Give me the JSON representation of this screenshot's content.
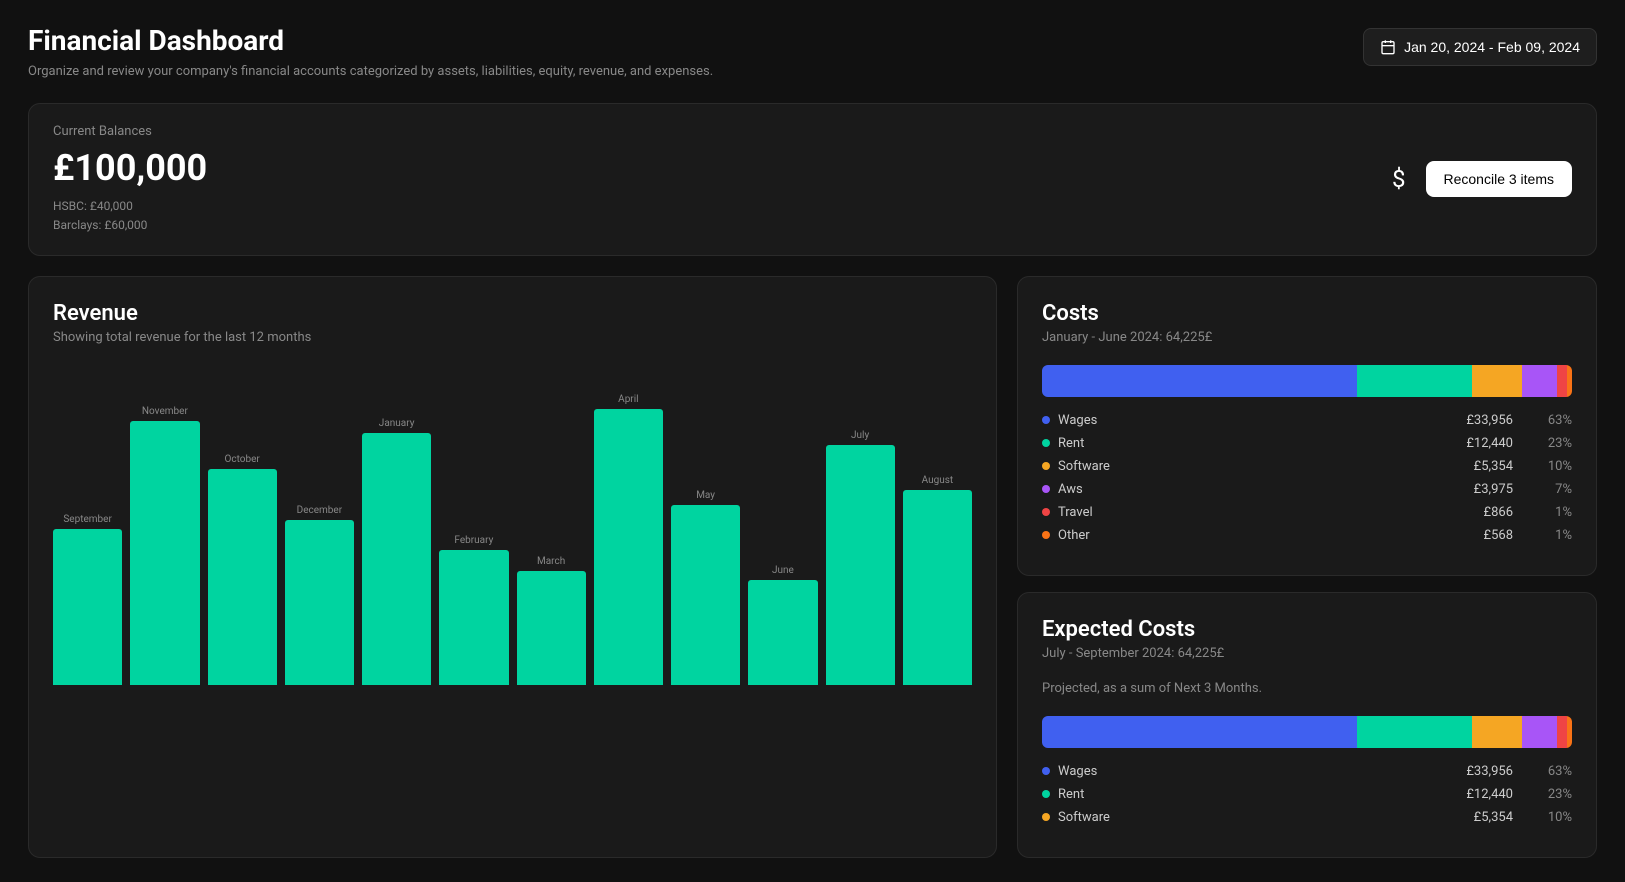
{
  "header": {
    "title": "Financial Dashboard",
    "subtitle": "Organize and review your company's financial accounts categorized by assets, liabilities, equity, revenue, and expenses.",
    "date_range": "Jan 20, 2024 - Feb 09, 2024"
  },
  "balances": {
    "label": "Current Balances",
    "total": "£100,000",
    "hsbc": "HSBC: £40,000",
    "barclays": "Barclays: £60,000",
    "reconcile_label": "Reconcile 3 items"
  },
  "revenue": {
    "title": "Revenue",
    "subtitle": "Showing total revenue for the last 12 months",
    "bars": [
      {
        "label": "September",
        "height_pct": 52
      },
      {
        "label": "November",
        "height_pct": 88
      },
      {
        "label": "October",
        "height_pct": 72
      },
      {
        "label": "December",
        "height_pct": 55
      },
      {
        "label": "January",
        "height_pct": 84
      },
      {
        "label": "February",
        "height_pct": 45
      },
      {
        "label": "March",
        "height_pct": 38
      },
      {
        "label": "April",
        "height_pct": 92
      },
      {
        "label": "May",
        "height_pct": 60
      },
      {
        "label": "June",
        "height_pct": 35
      },
      {
        "label": "July",
        "height_pct": 80
      },
      {
        "label": "August",
        "height_pct": 65
      }
    ]
  },
  "costs": {
    "title": "Costs",
    "period": "January - June 2024: 64,225£",
    "stacked_bar": [
      {
        "color": "#4060F0",
        "pct": 63
      },
      {
        "color": "#00D4A0",
        "pct": 23
      },
      {
        "color": "#F5A623",
        "pct": 10
      },
      {
        "color": "#A855F7",
        "pct": 7
      },
      {
        "color": "#EF4444",
        "pct": 2
      },
      {
        "color": "#F97316",
        "pct": 1
      }
    ],
    "items": [
      {
        "label": "Wages",
        "color": "#4060F0",
        "amount": "£33,956",
        "pct": "63%"
      },
      {
        "label": "Rent",
        "color": "#00D4A0",
        "amount": "£12,440",
        "pct": "23%"
      },
      {
        "label": "Software",
        "color": "#F5A623",
        "amount": "£5,354",
        "pct": "10%"
      },
      {
        "label": "Aws",
        "color": "#A855F7",
        "amount": "£3,975",
        "pct": "7%"
      },
      {
        "label": "Travel",
        "color": "#EF4444",
        "amount": "£866",
        "pct": "1%"
      },
      {
        "label": "Other",
        "color": "#F97316",
        "amount": "£568",
        "pct": "1%"
      }
    ]
  },
  "expected_costs": {
    "title": "Expected Costs",
    "period": "July - September 2024: 64,225£",
    "note": "Projected, as a sum of Next 3 Months.",
    "stacked_bar": [
      {
        "color": "#4060F0",
        "pct": 63
      },
      {
        "color": "#00D4A0",
        "pct": 23
      },
      {
        "color": "#F5A623",
        "pct": 10
      },
      {
        "color": "#A855F7",
        "pct": 7
      },
      {
        "color": "#EF4444",
        "pct": 2
      },
      {
        "color": "#F97316",
        "pct": 1
      }
    ],
    "items": [
      {
        "label": "Wages",
        "color": "#4060F0",
        "amount": "£33,956",
        "pct": "63%"
      },
      {
        "label": "Rent",
        "color": "#00D4A0",
        "amount": "£12,440",
        "pct": "23%"
      },
      {
        "label": "Software",
        "color": "#F5A623",
        "amount": "£5,354",
        "pct": "10%"
      }
    ]
  }
}
